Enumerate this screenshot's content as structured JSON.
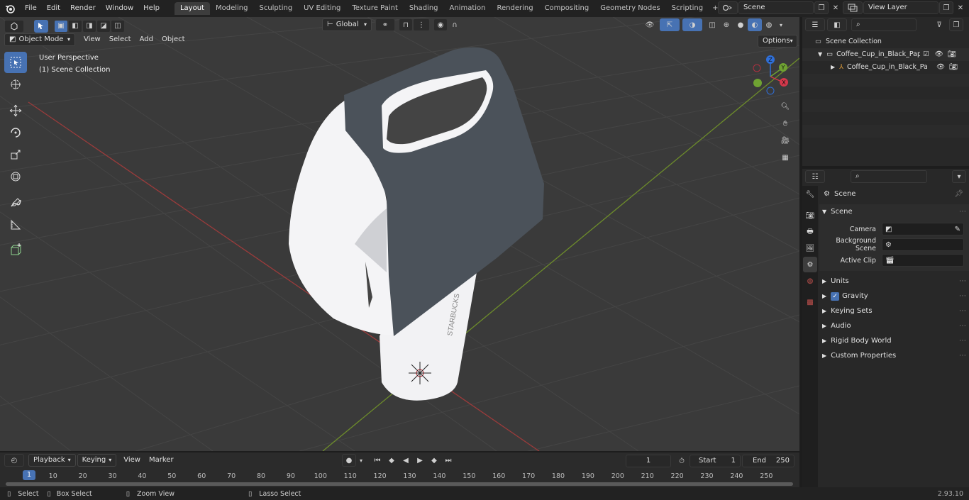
{
  "topbar": {
    "menus": [
      "File",
      "Edit",
      "Render",
      "Window",
      "Help"
    ],
    "workspaces": [
      "Layout",
      "Modeling",
      "Sculpting",
      "UV Editing",
      "Texture Paint",
      "Shading",
      "Animation",
      "Rendering",
      "Compositing",
      "Geometry Nodes",
      "Scripting"
    ],
    "active_workspace": "Layout",
    "add_tab_icon": "+",
    "scene_name": "Scene",
    "view_layer": "View Layer"
  },
  "viewport": {
    "mode": "Object Mode",
    "menus": [
      "View",
      "Select",
      "Add",
      "Object"
    ],
    "transform_orientation": "Global",
    "options_label": "Options",
    "overlay_title": "User Perspective",
    "overlay_subtitle": "(1) Scene Collection",
    "cup_brand_text": "STARBUCKS",
    "gizmo_axes": [
      "Z",
      "Y",
      "X"
    ],
    "colors": {
      "grid_x": "#9b3b3b",
      "grid_y": "#6d8c2b",
      "background": "#3a3a3a",
      "carrier": "#4b525a"
    }
  },
  "outliner": {
    "root": "Scene Collection",
    "items": [
      {
        "label": "Coffee_Cup_in_Black_Paper_",
        "level": 1
      },
      {
        "label": "Coffee_Cup_in_Black_Pa",
        "level": 2
      }
    ]
  },
  "properties": {
    "context": "Scene",
    "section": "Scene",
    "fields": [
      {
        "label": "Camera"
      },
      {
        "label": "Background Scene"
      },
      {
        "label": "Active Clip"
      }
    ],
    "panels": [
      "Units",
      "Gravity",
      "Keying Sets",
      "Audio",
      "Rigid Body World",
      "Custom Properties"
    ],
    "gravity_checked": true
  },
  "timeline": {
    "menus": [
      "Playback",
      "Keying",
      "View",
      "Marker"
    ],
    "current_frame": "1",
    "start_label": "Start",
    "start_value": "1",
    "end_label": "End",
    "end_value": "250",
    "ticks": [
      "10",
      "20",
      "30",
      "40",
      "50",
      "60",
      "70",
      "80",
      "90",
      "100",
      "110",
      "120",
      "130",
      "140",
      "150",
      "160",
      "170",
      "180",
      "190",
      "200",
      "210",
      "220",
      "230",
      "240",
      "250"
    ],
    "playhead_label": "1"
  },
  "statusbar": {
    "items": [
      "Select",
      "Box Select",
      "Zoom View",
      "Lasso Select"
    ],
    "version": "2.93.10"
  }
}
